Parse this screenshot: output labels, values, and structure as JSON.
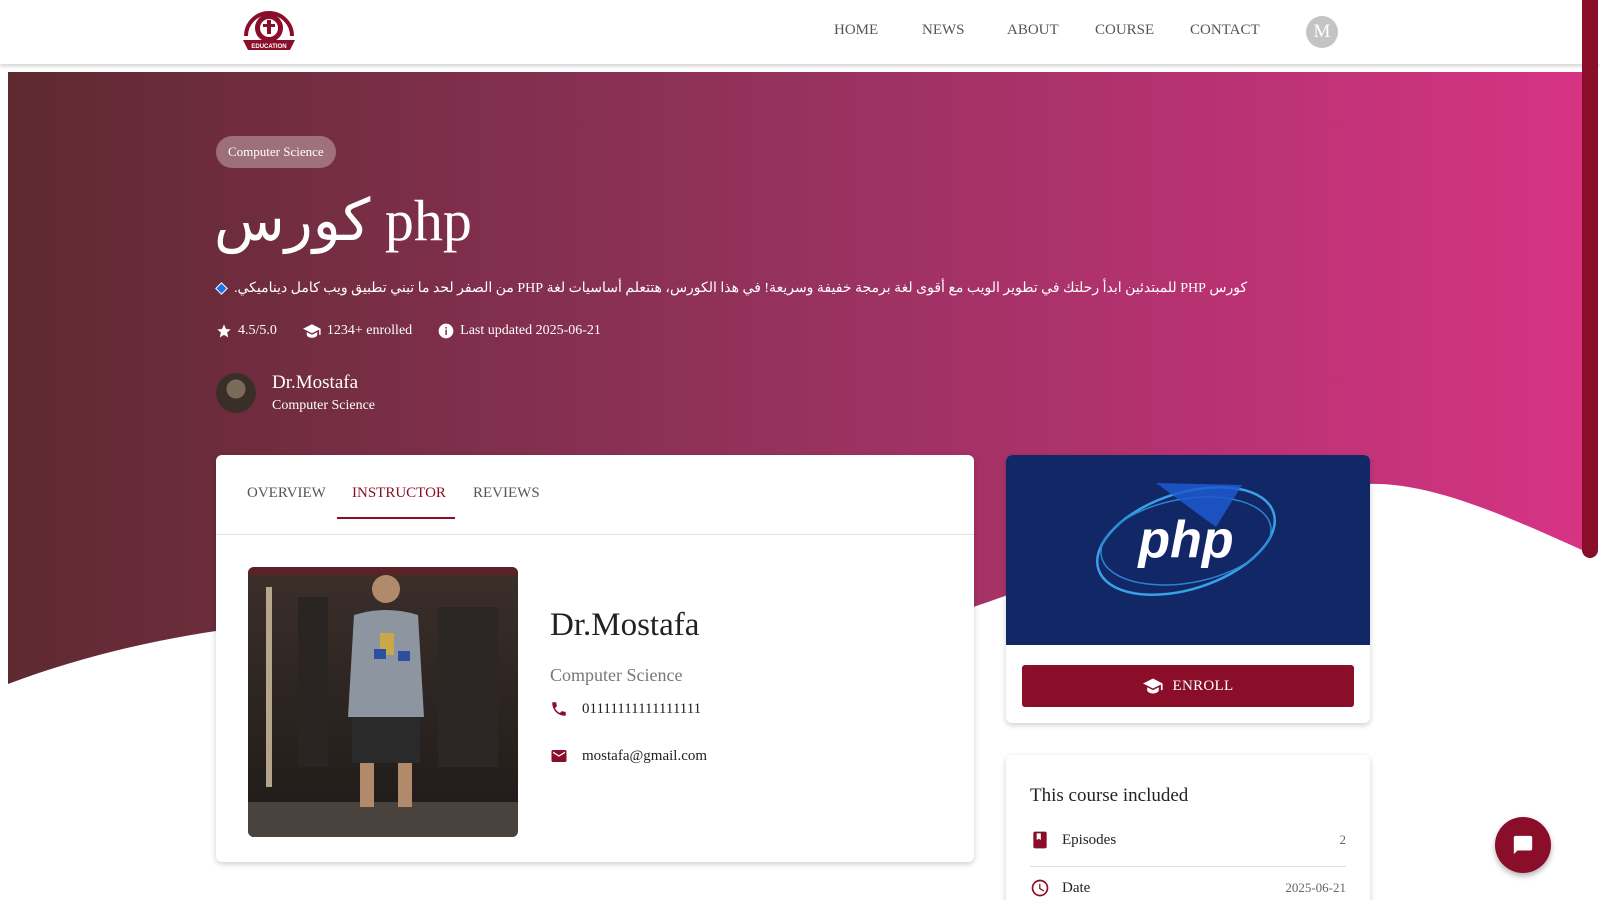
{
  "nav": {
    "home": "HOME",
    "news": "NEWS",
    "about": "ABOUT",
    "course": "COURSE",
    "contact": "CONTACT",
    "avatar_initial": "M",
    "logo_text": "EDUCATION"
  },
  "hero": {
    "category": "Computer Science",
    "title": "كورس php",
    "description": "كورس PHP للمبتدئين ابدأ رحلتك في تطوير الويب مع أقوى لغة برمجة خفيفة وسريعة! في هذا الكورس، هتتعلم أساسيات لغة PHP من الصفر لحد ما تبني تطبيق ويب كامل ديناميكي.",
    "rating": "4.5/5.0",
    "enrolled": "1234+ enrolled",
    "last_updated": "Last updated 2025-06-21",
    "instructor_name": "Dr.Mostafa",
    "instructor_role": "Computer Science"
  },
  "tabs": {
    "overview": "OVERVIEW",
    "instructor": "INSTRUCTOR",
    "reviews": "REVIEWS",
    "active": "INSTRUCTOR"
  },
  "instructor": {
    "name": "Dr.Mostafa",
    "role": "Computer Science",
    "phone": "01111111111111111",
    "email": "mostafa@gmail.com"
  },
  "enroll": {
    "banner_text": "php",
    "button_label": "ENROLL"
  },
  "included": {
    "title": "This course included",
    "episodes_label": "Episodes",
    "episodes_value": "2",
    "date_label": "Date",
    "date_value": "2025-06-21"
  },
  "colors": {
    "brand": "#8a0e2a",
    "hero_start": "#5e2a30",
    "hero_end": "#d63384",
    "php_banner": "#112766"
  },
  "icons": {
    "star": "star-icon",
    "enrolled": "graduation-cap-icon",
    "updated": "info-icon",
    "phone": "phone-icon",
    "email": "mail-icon",
    "episodes": "book-icon",
    "date": "clock-icon",
    "chat": "chat-icon"
  }
}
